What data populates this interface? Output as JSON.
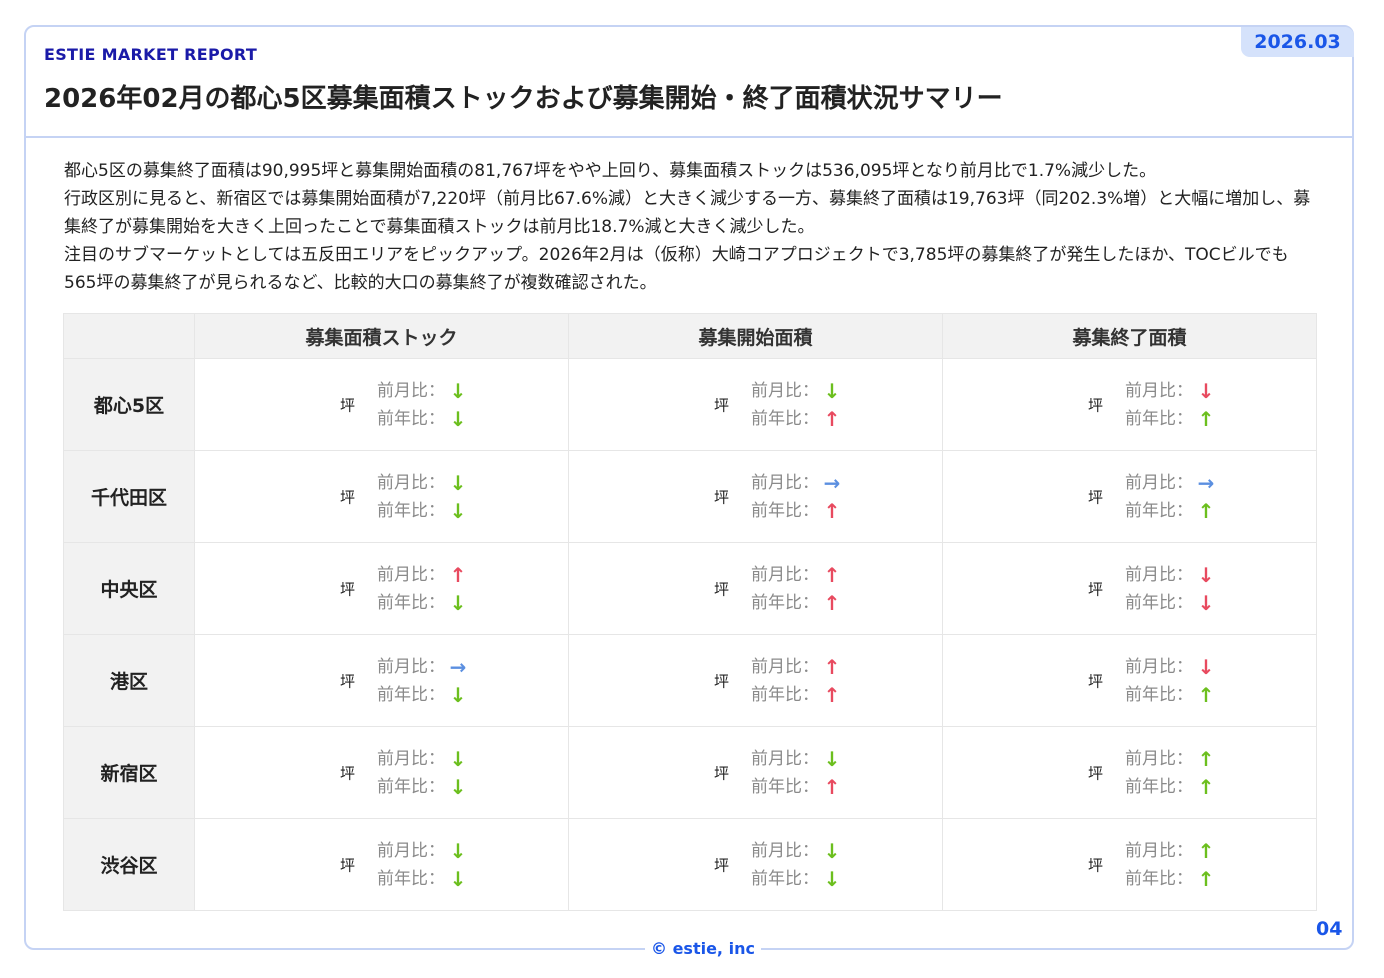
{
  "header": {
    "brand": "ESTIE MARKET REPORT",
    "date": "2026.03",
    "title": "2026年02月の都心5区募集面積ストックおよび募集開始・終了面積状況サマリー"
  },
  "summary": [
    "都心5区の募集終了面積は90,995坪と募集開始面積の81,767坪をやや上回り、募集面積ストックは536,095坪となり前月比で1.7%減少した。",
    "行政区別に見ると、新宿区では募集開始面積が7,220坪（前月比67.6%減）と大きく減少する一方、募集終了面積は19,763坪（同202.3%増）と大幅に増加し、募集終了が募集開始を大きく上回ったことで募集面積ストックは前月比18.7%減と大きく減少した。",
    "注目のサブマーケットとしては五反田エリアをピックアップ。2026年2月は（仮称）大崎コアプロジェクトで3,785坪の募集終了が発生したほか、TOCビルでも565坪の募集終了が見られるなど、比較的大口の募集終了が複数確認された。"
  ],
  "table": {
    "columns": [
      "募集面積ストック",
      "募集開始面積",
      "募集終了面積"
    ],
    "unit": "坪",
    "mom_label": "前月比：",
    "yoy_label": "前年比：",
    "rows": [
      {
        "area": "都心5区",
        "cells": [
          {
            "mom": "down",
            "yoy": "down"
          },
          {
            "mom": "down",
            "yoy": "up"
          },
          {
            "mom": "down",
            "yoy": "up"
          }
        ]
      },
      {
        "area": "千代田区",
        "cells": [
          {
            "mom": "down",
            "yoy": "down"
          },
          {
            "mom": "flat",
            "yoy": "up"
          },
          {
            "mom": "flat",
            "yoy": "up"
          }
        ]
      },
      {
        "area": "中央区",
        "cells": [
          {
            "mom": "up",
            "yoy": "down"
          },
          {
            "mom": "up",
            "yoy": "up"
          },
          {
            "mom": "down",
            "yoy": "down"
          }
        ]
      },
      {
        "area": "港区",
        "cells": [
          {
            "mom": "flat",
            "yoy": "down"
          },
          {
            "mom": "up",
            "yoy": "up"
          },
          {
            "mom": "down",
            "yoy": "up"
          }
        ]
      },
      {
        "area": "新宿区",
        "cells": [
          {
            "mom": "down",
            "yoy": "down"
          },
          {
            "mom": "down",
            "yoy": "up"
          },
          {
            "mom": "up",
            "yoy": "up"
          }
        ]
      },
      {
        "area": "渋谷区",
        "cells": [
          {
            "mom": "down",
            "yoy": "down"
          },
          {
            "mom": "down",
            "yoy": "down"
          },
          {
            "mom": "up",
            "yoy": "up"
          }
        ]
      }
    ]
  },
  "arrow_colors": {
    "stock": {
      "down": "#6cbf1e",
      "up": "#e84a5f",
      "flat": "#5b8fe0"
    },
    "start": {
      "down": "#6cbf1e",
      "up": "#e84a5f",
      "flat": "#5b8fe0"
    },
    "end": {
      "down": "#e84a5f",
      "up": "#6cbf1e",
      "flat": "#5b8fe0"
    }
  },
  "footer": {
    "copyright": "© estie, inc",
    "page": "04"
  }
}
